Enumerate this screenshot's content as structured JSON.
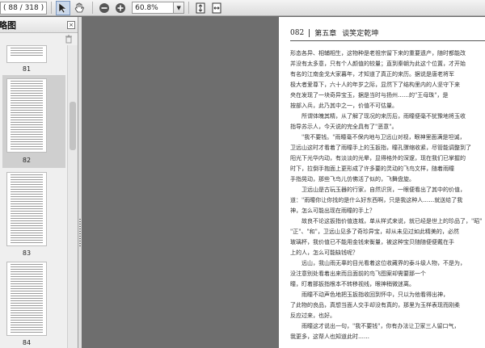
{
  "toolbar": {
    "page_indicator": "( 88 / 318 )",
    "zoom_value": "60.8%",
    "zoom_arrow": "▼"
  },
  "sidebar": {
    "title": "略图",
    "close_glyph": "×",
    "thumbnails": [
      {
        "label": "81"
      },
      {
        "label": "82"
      },
      {
        "label": "83"
      },
      {
        "label": "84"
      }
    ]
  },
  "page": {
    "number": "082",
    "chapter": "第五章",
    "chapter_title": "谈笑定乾坤",
    "paragraphs": [
      "形态各异、相辅相生，这物种是老祖宗留下来的重要遗产，随时都能改",
      "并没有太多意，只有个人颜值的较量；直到秦朝为此这个位置，才开始",
      "有名的江南金戈大家暮年，才知道了真正的来历。据说是唐老将军",
      "极大者爱尊下，六十人的年岁之际，显然下了结构里内的人坚守下来",
      "央在发现了一块奇异宝玉，据是当时与扬州……的\"王母珠\"，是",
      "按部入兵，此乃其中之一，价值不可估量。",
      "　　所谓体魄其精，从了解了现况的来历后，雨瞳便毫不犹豫地将玉收",
      "指导苏示人，今天说的完全具有了\"恶意\"。",
      "　　\"我不要钱。\"雨瞳毫不保内地与卫远山对视，眼神里面满是坦诚，",
      "卫远山这时才看着了雨瞳手上的玉扳指，瞳孔骤缩收紧，尽管能调整到了",
      "阳光下光华内动，有淡淡的光晕，显得格外的深邃，现在我们已掌握的",
      "时下，拉倒手抱面上更形成了许多要的灵动的飞鸟文样，随着雨瞳",
      "手指晃动，那些飞鸟儿仿佛活了似的，飞舞盘旋。",
      "　　卫远山是古玩玉器的行家，自然识货，一眼便看出了其中的价值，",
      "道：\"雨瞳你让你找的是什么好东西啊，只是我这种人……就送给了我",
      "神，怎么可能出现在雨瞳的手上？",
      "　　故良不论这扳指价值连城，单从样式来说，就已经是世上的珍品了，\"昭\"",
      "\"正\"、\"和\"，卫远山见多了奇珍异宝，却从未见过如此精美的，必然",
      "玻璃杯，我价值已不能用金钱来衡量，被这种宝贝随随便便戴在手",
      "上的人，怎么可能缺钱呢？",
      "　　远山，我山雨无辜的目光看着这位收藏界的泰斗级人物，不是为，",
      "没注意别处看着出来而且面前的鸟飞图案却需要那一个",
      "瞳，盯着那扳指根本不转移视线，眼神稍微迷离。",
      "　　雨瞳不动声色地把玉扳指收回到怀中，只以为他看得出神，",
      "了此物的良品，真想当面人交手却没有真的，那里为玉样表现而刚柔",
      "反应过来，也好。",
      "　　雨瞳这才说出一句，\"我不要钱\"，你有办法让卫家三人留口气，",
      "我更多，这帮人也知道此时……"
    ]
  }
}
